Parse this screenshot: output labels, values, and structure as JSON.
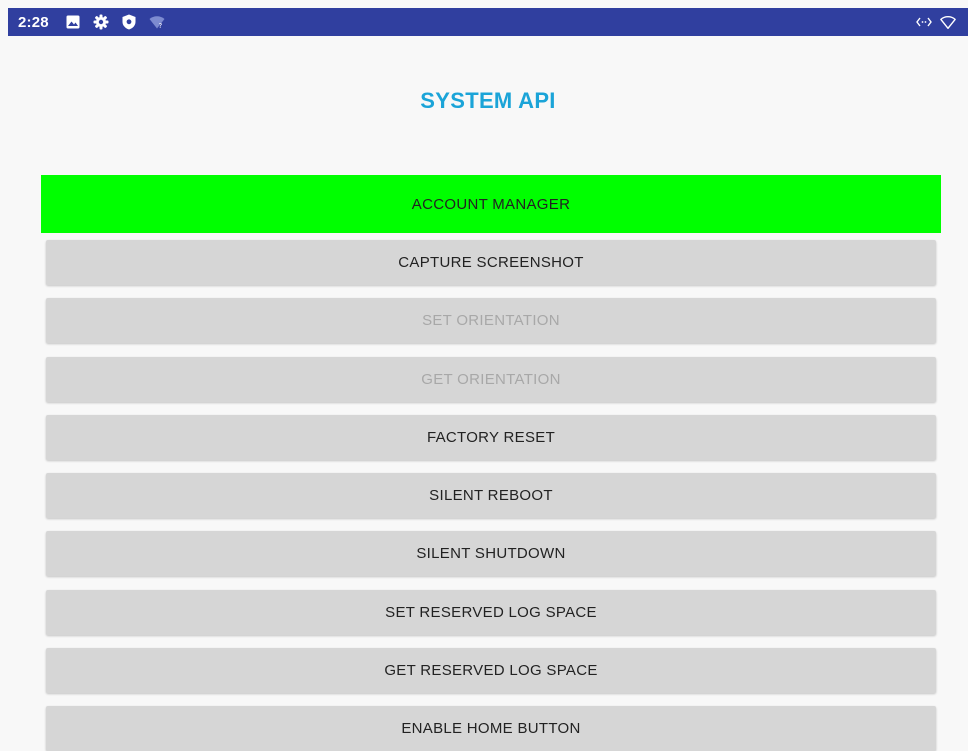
{
  "status_bar": {
    "time": "2:28",
    "left_icons": [
      "image-icon",
      "gear-icon",
      "shield-icon",
      "wifi-question-icon"
    ],
    "right_icons": [
      "data-saver-icon",
      "wifi-outline-icon"
    ],
    "bar_color": "#303f9f"
  },
  "page": {
    "title": "SYSTEM API",
    "title_color": "#1ba4d8"
  },
  "buttons": [
    {
      "label": "ACCOUNT MANAGER",
      "state": "highlighted",
      "color": "#00ff00"
    },
    {
      "label": "CAPTURE SCREENSHOT",
      "state": "enabled"
    },
    {
      "label": "SET ORIENTATION",
      "state": "disabled"
    },
    {
      "label": "GET ORIENTATION",
      "state": "disabled"
    },
    {
      "label": "FACTORY RESET",
      "state": "enabled"
    },
    {
      "label": "SILENT REBOOT",
      "state": "enabled"
    },
    {
      "label": "SILENT SHUTDOWN",
      "state": "enabled"
    },
    {
      "label": "SET RESERVED LOG SPACE",
      "state": "enabled"
    },
    {
      "label": "GET RESERVED LOG SPACE",
      "state": "enabled"
    },
    {
      "label": "ENABLE HOME BUTTON",
      "state": "enabled"
    }
  ]
}
